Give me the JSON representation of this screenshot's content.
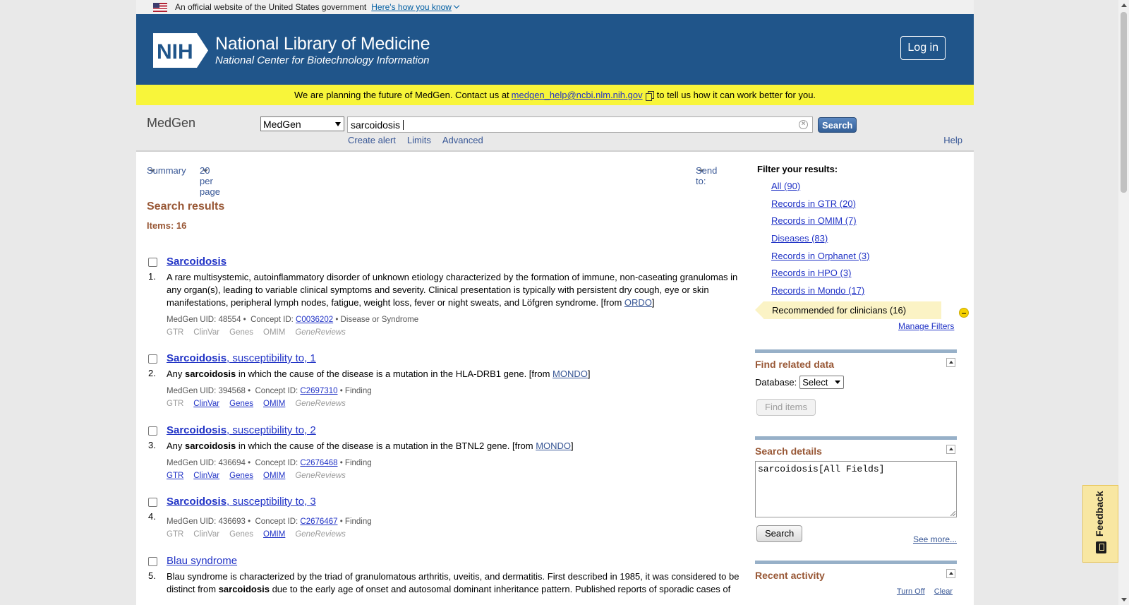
{
  "gov_banner": {
    "text": "An official website of the United States government",
    "link": "Here's how you know"
  },
  "header": {
    "badge": "NIH",
    "title": "National Library of Medicine",
    "subtitle": "National Center for Biotechnology Information",
    "login": "Log in"
  },
  "notice": {
    "pre": "We are planning the future of MedGen. Contact us at",
    "email": "medgen_help@ncbi.nlm.nih.gov",
    "post": "to tell us how it can work better for you."
  },
  "search": {
    "db_label": "MedGen",
    "db_selected": "MedGen",
    "term": "sarcoidosis",
    "button": "Search",
    "links": [
      "Create alert",
      "Limits",
      "Advanced"
    ],
    "help": "Help"
  },
  "toolbar": {
    "format": "Summary",
    "per_page": "20 per page",
    "send_to": "Send to:"
  },
  "results_title": "Search results",
  "items_count": "Items: 16",
  "results": [
    {
      "num": "1.",
      "title_bold": "Sarcoidosis",
      "title_rest": "",
      "desc_parts": [
        "A rare multisystemic, autoinflammatory disorder of unknown etiology characterized by the formation of immune, non-caseating granulomas in any organ(s), leading to variable clinical symptoms and severity. Clinical presentation is typically with persistent dry cough, eye or skin manifestations, peripheral lymph nodes, fatigue, weight loss, fever or night sweats, and Löfgren syndrome. [from ",
        "ORDO",
        "]"
      ],
      "uid": "MedGen UID: 48554 •",
      "concept_label": "Concept ID:",
      "concept": "C0036202",
      "type": "• Disease or Syndrome",
      "links": [
        "GTR",
        "ClinVar",
        "Genes",
        "OMIM",
        "GeneReviews"
      ]
    },
    {
      "num": "2.",
      "title_bold": "Sarcoidosis",
      "title_rest": ", susceptibility to, 1",
      "desc_a": "Any ",
      "desc_b": "sarcoidosis",
      "desc_c": " in which the cause of the disease is a mutation in the HLA-DRB1 gene. [from ",
      "desc_src": "MONDO",
      "desc_end": "]",
      "uid": "MedGen UID: 394568 •",
      "concept_label": "Concept ID:",
      "concept": "C2697310",
      "type": "• Finding",
      "links": [
        "GTR",
        "ClinVar",
        "Genes",
        "OMIM",
        "GeneReviews"
      ]
    },
    {
      "num": "3.",
      "title_bold": "Sarcoidosis",
      "title_rest": ", susceptibility to, 2",
      "desc_a": "Any ",
      "desc_b": "sarcoidosis",
      "desc_c": " in which the cause of the disease is a mutation in the BTNL2 gene. [from ",
      "desc_src": "MONDO",
      "desc_end": "]",
      "uid": "MedGen UID: 436694 •",
      "concept_label": "Concept ID:",
      "concept": "C2676468",
      "type": "• Finding",
      "links": [
        "GTR",
        "ClinVar",
        "Genes",
        "OMIM",
        "GeneReviews"
      ]
    },
    {
      "num": "4.",
      "title_bold": "Sarcoidosis",
      "title_rest": ", susceptibility to, 3",
      "uid": "MedGen UID: 436693 •",
      "concept_label": "Concept ID:",
      "concept": "C2676467",
      "type": "• Finding",
      "links": [
        "GTR",
        "ClinVar",
        "Genes",
        "OMIM",
        "GeneReviews"
      ]
    },
    {
      "num": "5.",
      "title": "Blau syndrome",
      "desc_a": "Blau syndrome is characterized by the triad of granulomatous arthritis, uveitis, and dermatitis. First described in 1985, it was considered to be distinct from ",
      "desc_b": "sarcoidosis",
      "desc_c": " due to the early age of onset and autosomal dominant inheritance pattern. Published reports of sporadic cases of"
    }
  ],
  "sidebar": {
    "filter_heading": "Filter your results:",
    "filters": [
      "All (90)",
      "Records in GTR (20)",
      "Records in OMIM (7)",
      "Diseases (83)",
      "Records in Orphanet (3)",
      "Records in HPO (3)",
      "Records in Mondo (17)"
    ],
    "recommended": "Recommended for clinicians (16)",
    "manage": "Manage Filters",
    "related_heading": "Find related data",
    "database_label": "Database:",
    "database_value": "Select",
    "find_items": "Find items",
    "details_heading": "Search details",
    "details_query": "sarcoidosis[All Fields]",
    "details_search": "Search",
    "see_more": "See more...",
    "recent_heading": "Recent activity",
    "turn_off": "Turn Off",
    "clear": "Clear"
  },
  "feedback": "Feedback",
  "colors": {
    "header_bg": "#20558a",
    "notice_bg": "#f8f53a",
    "link": "#2133c6",
    "section_heading": "#985735"
  }
}
